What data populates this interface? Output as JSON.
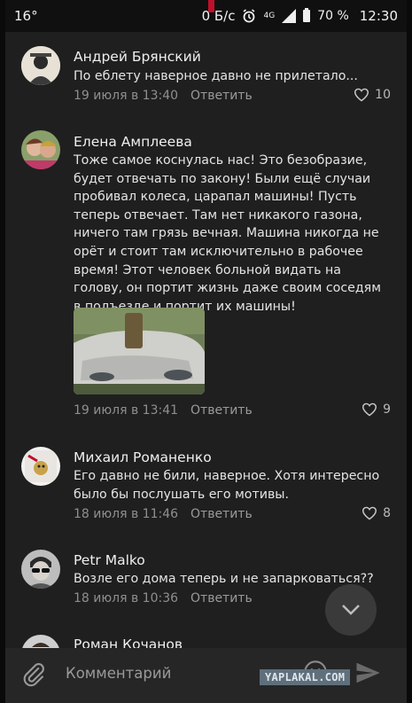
{
  "status_bar": {
    "temperature": "16°",
    "network_speed": "0 Б/с",
    "lte": "4G",
    "battery": "70 %",
    "time": "12:30"
  },
  "comments": [
    {
      "author": "Андрей Брянский",
      "text": "По еблету наверное давно не прилетало...",
      "date": "19 июля в 13:40",
      "reply": "Ответить",
      "likes": "10",
      "avatar_icon": "avatar-icon"
    },
    {
      "author": "Елена Амплеева",
      "text": "Тоже самое коснулась нас! Это безобразие, будет отвечать по закону! Были ещё случаи пробивал колеса, царапал машины! Пусть теперь отвечает. Там нет никакого газона, ничего там грязь вечная. Машина никогда не орёт и стоит там исключительно в рабочее время! Этот человек больной видать на голову, он портит жизнь даже своим соседям в подъезде и портит их машины!",
      "date": "19 июля в 13:41",
      "reply": "Ответить",
      "likes": "9",
      "avatar_icon": "avatar-icon",
      "attachment": "car-photo"
    },
    {
      "author": "Михаил Романенко",
      "text": "Его давно не били, наверное. Хотя интересно было бы послушать его мотивы.",
      "date": "18 июля в 11:46",
      "reply": "Ответить",
      "likes": "8",
      "avatar_icon": "avatar-icon"
    },
    {
      "author": "Petr Malko",
      "text": "Возле его дома теперь и не запарковаться??",
      "date": "18 июля в 10:36",
      "reply": "Ответить",
      "likes": "",
      "avatar_icon": "avatar-icon"
    },
    {
      "author": "Роман Кочанов",
      "text": "",
      "date": "",
      "reply": "",
      "likes": "",
      "avatar_icon": "avatar-icon"
    }
  ],
  "input": {
    "placeholder": "Комментарий"
  },
  "watermark": "YAPLAKAL.COM",
  "colors": {
    "background": "#1f1f1f",
    "meta_text": "#8f8f8f",
    "accent_red": "#c0102a"
  }
}
